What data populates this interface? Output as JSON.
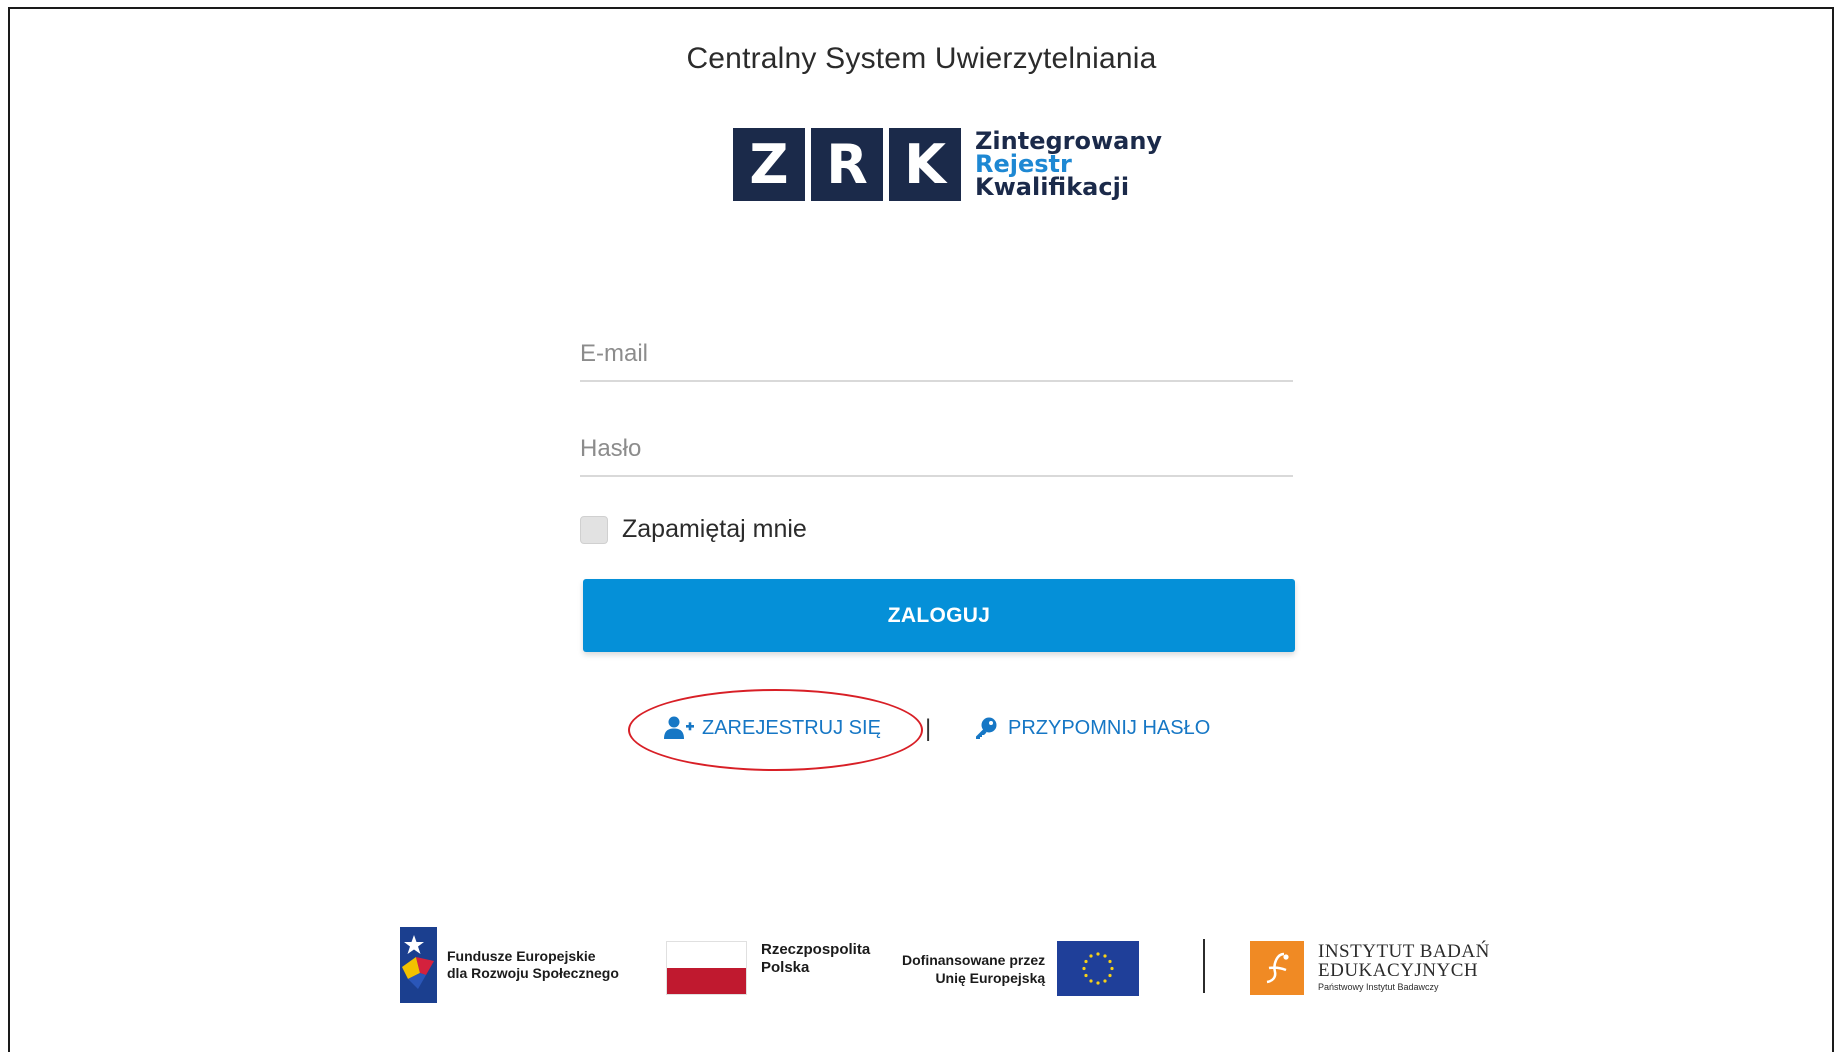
{
  "header": {
    "title": "Centralny System Uwierzytelniania"
  },
  "logo": {
    "letters": [
      "Z",
      "R",
      "K"
    ],
    "line1": "Zintegrowany",
    "line2": "Rejestr",
    "line3": "Kwalifikacji"
  },
  "form": {
    "email_placeholder": "E-mail",
    "password_placeholder": "Hasło",
    "remember_label": "Zapamiętaj mnie",
    "remember_checked": false,
    "login_label": "ZALOGUJ"
  },
  "links": {
    "register_label": "ZAREJESTRUJ SIĘ",
    "separator": "|",
    "remind_label": "PRZYPOMNIJ HASŁO"
  },
  "footer": {
    "fe_line1": "Fundusze Europejskie",
    "fe_line2": "dla Rozwoju Społecznego",
    "pl_line1": "Rzeczpospolita",
    "pl_line2": "Polska",
    "eu_line1": "Dofinansowane przez",
    "eu_line2": "Unię Europejską",
    "ibe_line1": "INSTYTUT BADAŃ",
    "ibe_line2": "EDUKACYJNYCH",
    "ibe_line3": "Państwowy Instytut Badawczy"
  },
  "icons": {
    "register": "user-plus-icon",
    "remind": "key-icon"
  },
  "colors": {
    "accent": "#0590d8",
    "link": "#1677c5",
    "logo_navy": "#1b2a4a",
    "logo_blue": "#1e88d3",
    "annotation": "#d81f26"
  }
}
